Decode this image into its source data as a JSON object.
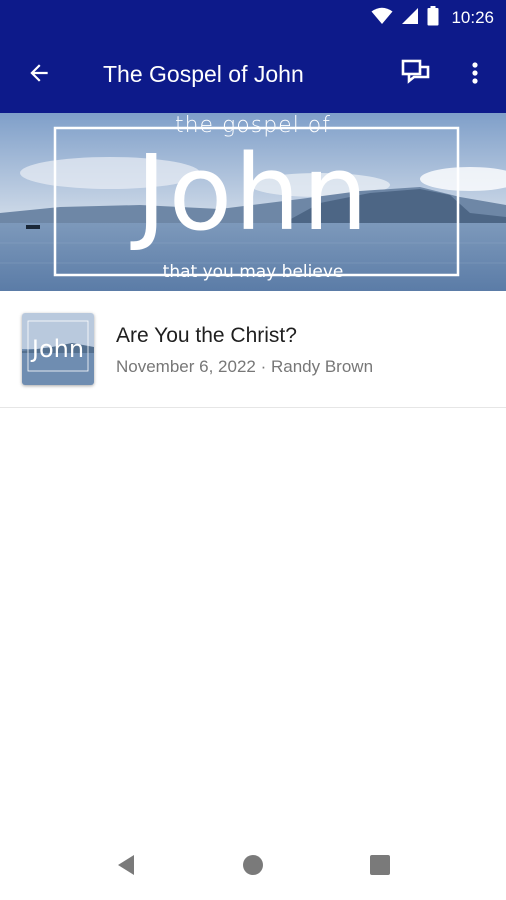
{
  "status_bar": {
    "time": "10:26",
    "icons": [
      "wifi-icon",
      "signal-icon",
      "battery-icon"
    ]
  },
  "app_bar": {
    "title": "The Gospel of John",
    "back_icon": "arrow-back-icon",
    "chat_icon": "chat-bubbles-icon",
    "more_icon": "more-vertical-icon",
    "background_color": "#0d1a8a"
  },
  "banner": {
    "top_text": "the gospel of",
    "main_text": "John",
    "bottom_text": "that you may believe"
  },
  "sermons": [
    {
      "title": "Are You the Christ?",
      "meta": "November 6, 2022 · Randy Brown",
      "thumb_text": "John"
    }
  ],
  "nav_bar": {
    "back_icon": "nav-back-triangle-icon",
    "home_icon": "nav-home-circle-icon",
    "recents_icon": "nav-recents-square-icon"
  }
}
